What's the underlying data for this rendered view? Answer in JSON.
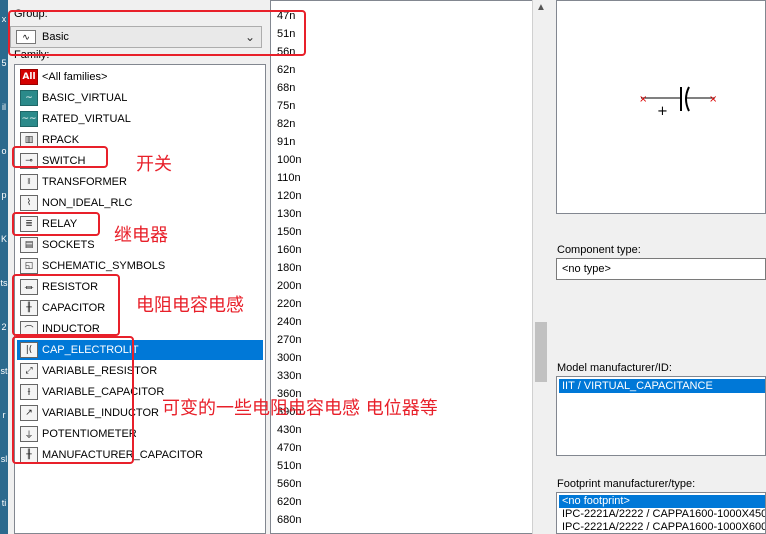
{
  "left_panel": {
    "group_label": "Group:",
    "group_value": "Basic",
    "family_label": "Family:",
    "families": [
      {
        "icon": "All",
        "label": "<All families>",
        "style": "all"
      },
      {
        "icon": "~",
        "label": "BASIC_VIRTUAL",
        "style": "teal"
      },
      {
        "icon": "~~",
        "label": "RATED_VIRTUAL",
        "style": "teal"
      },
      {
        "icon": "▥",
        "label": "RPACK",
        "style": ""
      },
      {
        "icon": "⊸",
        "label": "SWITCH",
        "style": ""
      },
      {
        "icon": "⧚",
        "label": "TRANSFORMER",
        "style": ""
      },
      {
        "icon": "⌇",
        "label": "NON_IDEAL_RLC",
        "style": ""
      },
      {
        "icon": "≣",
        "label": "RELAY",
        "style": ""
      },
      {
        "icon": "▤",
        "label": "SOCKETS",
        "style": ""
      },
      {
        "icon": "◱",
        "label": "SCHEMATIC_SYMBOLS",
        "style": ""
      },
      {
        "icon": "⏛",
        "label": "RESISTOR",
        "style": ""
      },
      {
        "icon": "╫",
        "label": "CAPACITOR",
        "style": ""
      },
      {
        "icon": "⌒",
        "label": "INDUCTOR",
        "style": ""
      },
      {
        "icon": "|(",
        "label": "CAP_ELECTROLIT",
        "style": ""
      },
      {
        "icon": "⤢",
        "label": "VARIABLE_RESISTOR",
        "style": ""
      },
      {
        "icon": "⫲",
        "label": "VARIABLE_CAPACITOR",
        "style": ""
      },
      {
        "icon": "↗",
        "label": "VARIABLE_INDUCTOR",
        "style": ""
      },
      {
        "icon": "⏚",
        "label": "POTENTIOMETER",
        "style": ""
      },
      {
        "icon": "╫",
        "label": "MANUFACTURER_CAPACITOR",
        "style": ""
      }
    ],
    "selected_family": "CAP_ELECTROLIT"
  },
  "values_list": [
    "47n",
    "51n",
    "56n",
    "62n",
    "68n",
    "75n",
    "82n",
    "91n",
    "100n",
    "110n",
    "120n",
    "130n",
    "150n",
    "160n",
    "180n",
    "200n",
    "220n",
    "240n",
    "270n",
    "300n",
    "330n",
    "360n",
    "390n",
    "430n",
    "470n",
    "510n",
    "560n",
    "620n",
    "680n"
  ],
  "right_panel": {
    "component_type_label": "Component type:",
    "component_type_value": "<no type>",
    "model_label": "Model manufacturer/ID:",
    "model_selected": "IIT / VIRTUAL_CAPACITANCE",
    "footprint_label": "Footprint manufacturer/type:",
    "footprints": [
      "<no footprint>",
      "IPC-2221A/2222 / CAPPA1600-1000X450",
      "IPC-2221A/2222 / CAPPA1600-1000X600"
    ]
  },
  "desktop_strip": [
    "x",
    "5",
    "il",
    "o",
    "p",
    "K",
    "ts",
    "2",
    "st",
    "r",
    "sl",
    "ti"
  ],
  "annotations": {
    "switch_note": "开关",
    "relay_note": "继电器",
    "rlc_note": "电阻电容电感",
    "variable_note": "可变的一些电阻电容电感 电位器等",
    "accent_color": "#e8202a",
    "selection_color": "#0078d7"
  }
}
